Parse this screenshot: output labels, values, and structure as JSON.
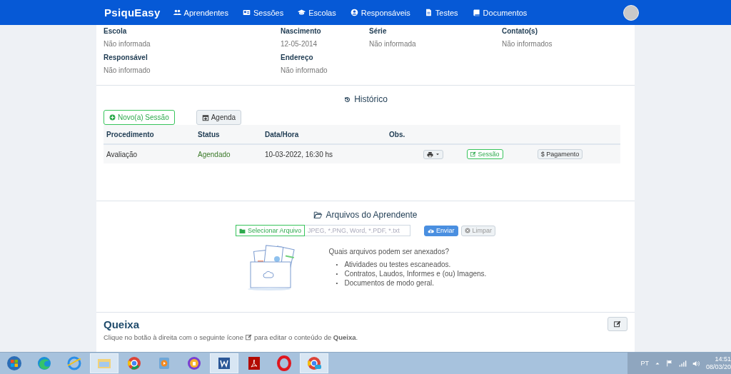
{
  "navbar": {
    "brand": "PsiquEasy",
    "items": [
      {
        "label": "Aprendentes"
      },
      {
        "label": "Sessões"
      },
      {
        "label": "Escolas"
      },
      {
        "label": "Responsáveis"
      },
      {
        "label": "Testes"
      },
      {
        "label": "Documentos"
      }
    ]
  },
  "details": [
    {
      "label": "Escola",
      "value": "Não informada"
    },
    {
      "label": "Nascimento",
      "value": "12-05-2014"
    },
    {
      "label": "Série",
      "value": "Não informada"
    },
    {
      "label": "Contato(s)",
      "value": "Não informados"
    },
    {
      "label": "Responsável",
      "value": "Não informado"
    },
    {
      "label": "Endereço",
      "value": "Não informado"
    }
  ],
  "history": {
    "title": "Histórico",
    "buttons": [
      "Novo(a) Sessão",
      "Agenda"
    ],
    "columns": [
      "Procedimento",
      "Status",
      "Data/Hora",
      "Obs."
    ],
    "rows": [
      {
        "procedure": "Avaliação",
        "status": "Agendado",
        "datetime": "10-03-2022, 16:30 hs",
        "actions": [
          "Sessão",
          "$ Pagamento"
        ]
      }
    ]
  },
  "files": {
    "title": "Arquivos do Aprendente",
    "select_button": "Selecionar Arquivo",
    "placeholder": "JPEG, *.PNG, Word, *.PDF, *.txt",
    "send_button": "Enviar",
    "clear_button": "Limpar",
    "question": "Quais arquivos podem ser anexados?",
    "items": [
      {
        "bullet": "•",
        "text": "Atividades ou testes escaneados."
      },
      {
        "bullet": "•",
        "text": "Contratos, Laudos, Informes e (ou) Imagens."
      },
      {
        "bullet": "•",
        "text": "Documentos de modo geral."
      }
    ]
  },
  "complaint": {
    "title": "Queixa",
    "hint": "Clique no botão à direita com o seguinte ícone",
    "hint_end": "para editar o conteúdo de **Queixa**."
  },
  "taskbar": {
    "apps": [
      {
        "active": false
      },
      {
        "active": false
      },
      {
        "active": true
      },
      {
        "active": false
      },
      {
        "active": false
      },
      {
        "active": false
      },
      {
        "active": true
      },
      {
        "active": false
      },
      {
        "active": false
      },
      {
        "active": true
      }
    ],
    "language": "PT",
    "time": "14:51",
    "date": "08/03/20"
  }
}
